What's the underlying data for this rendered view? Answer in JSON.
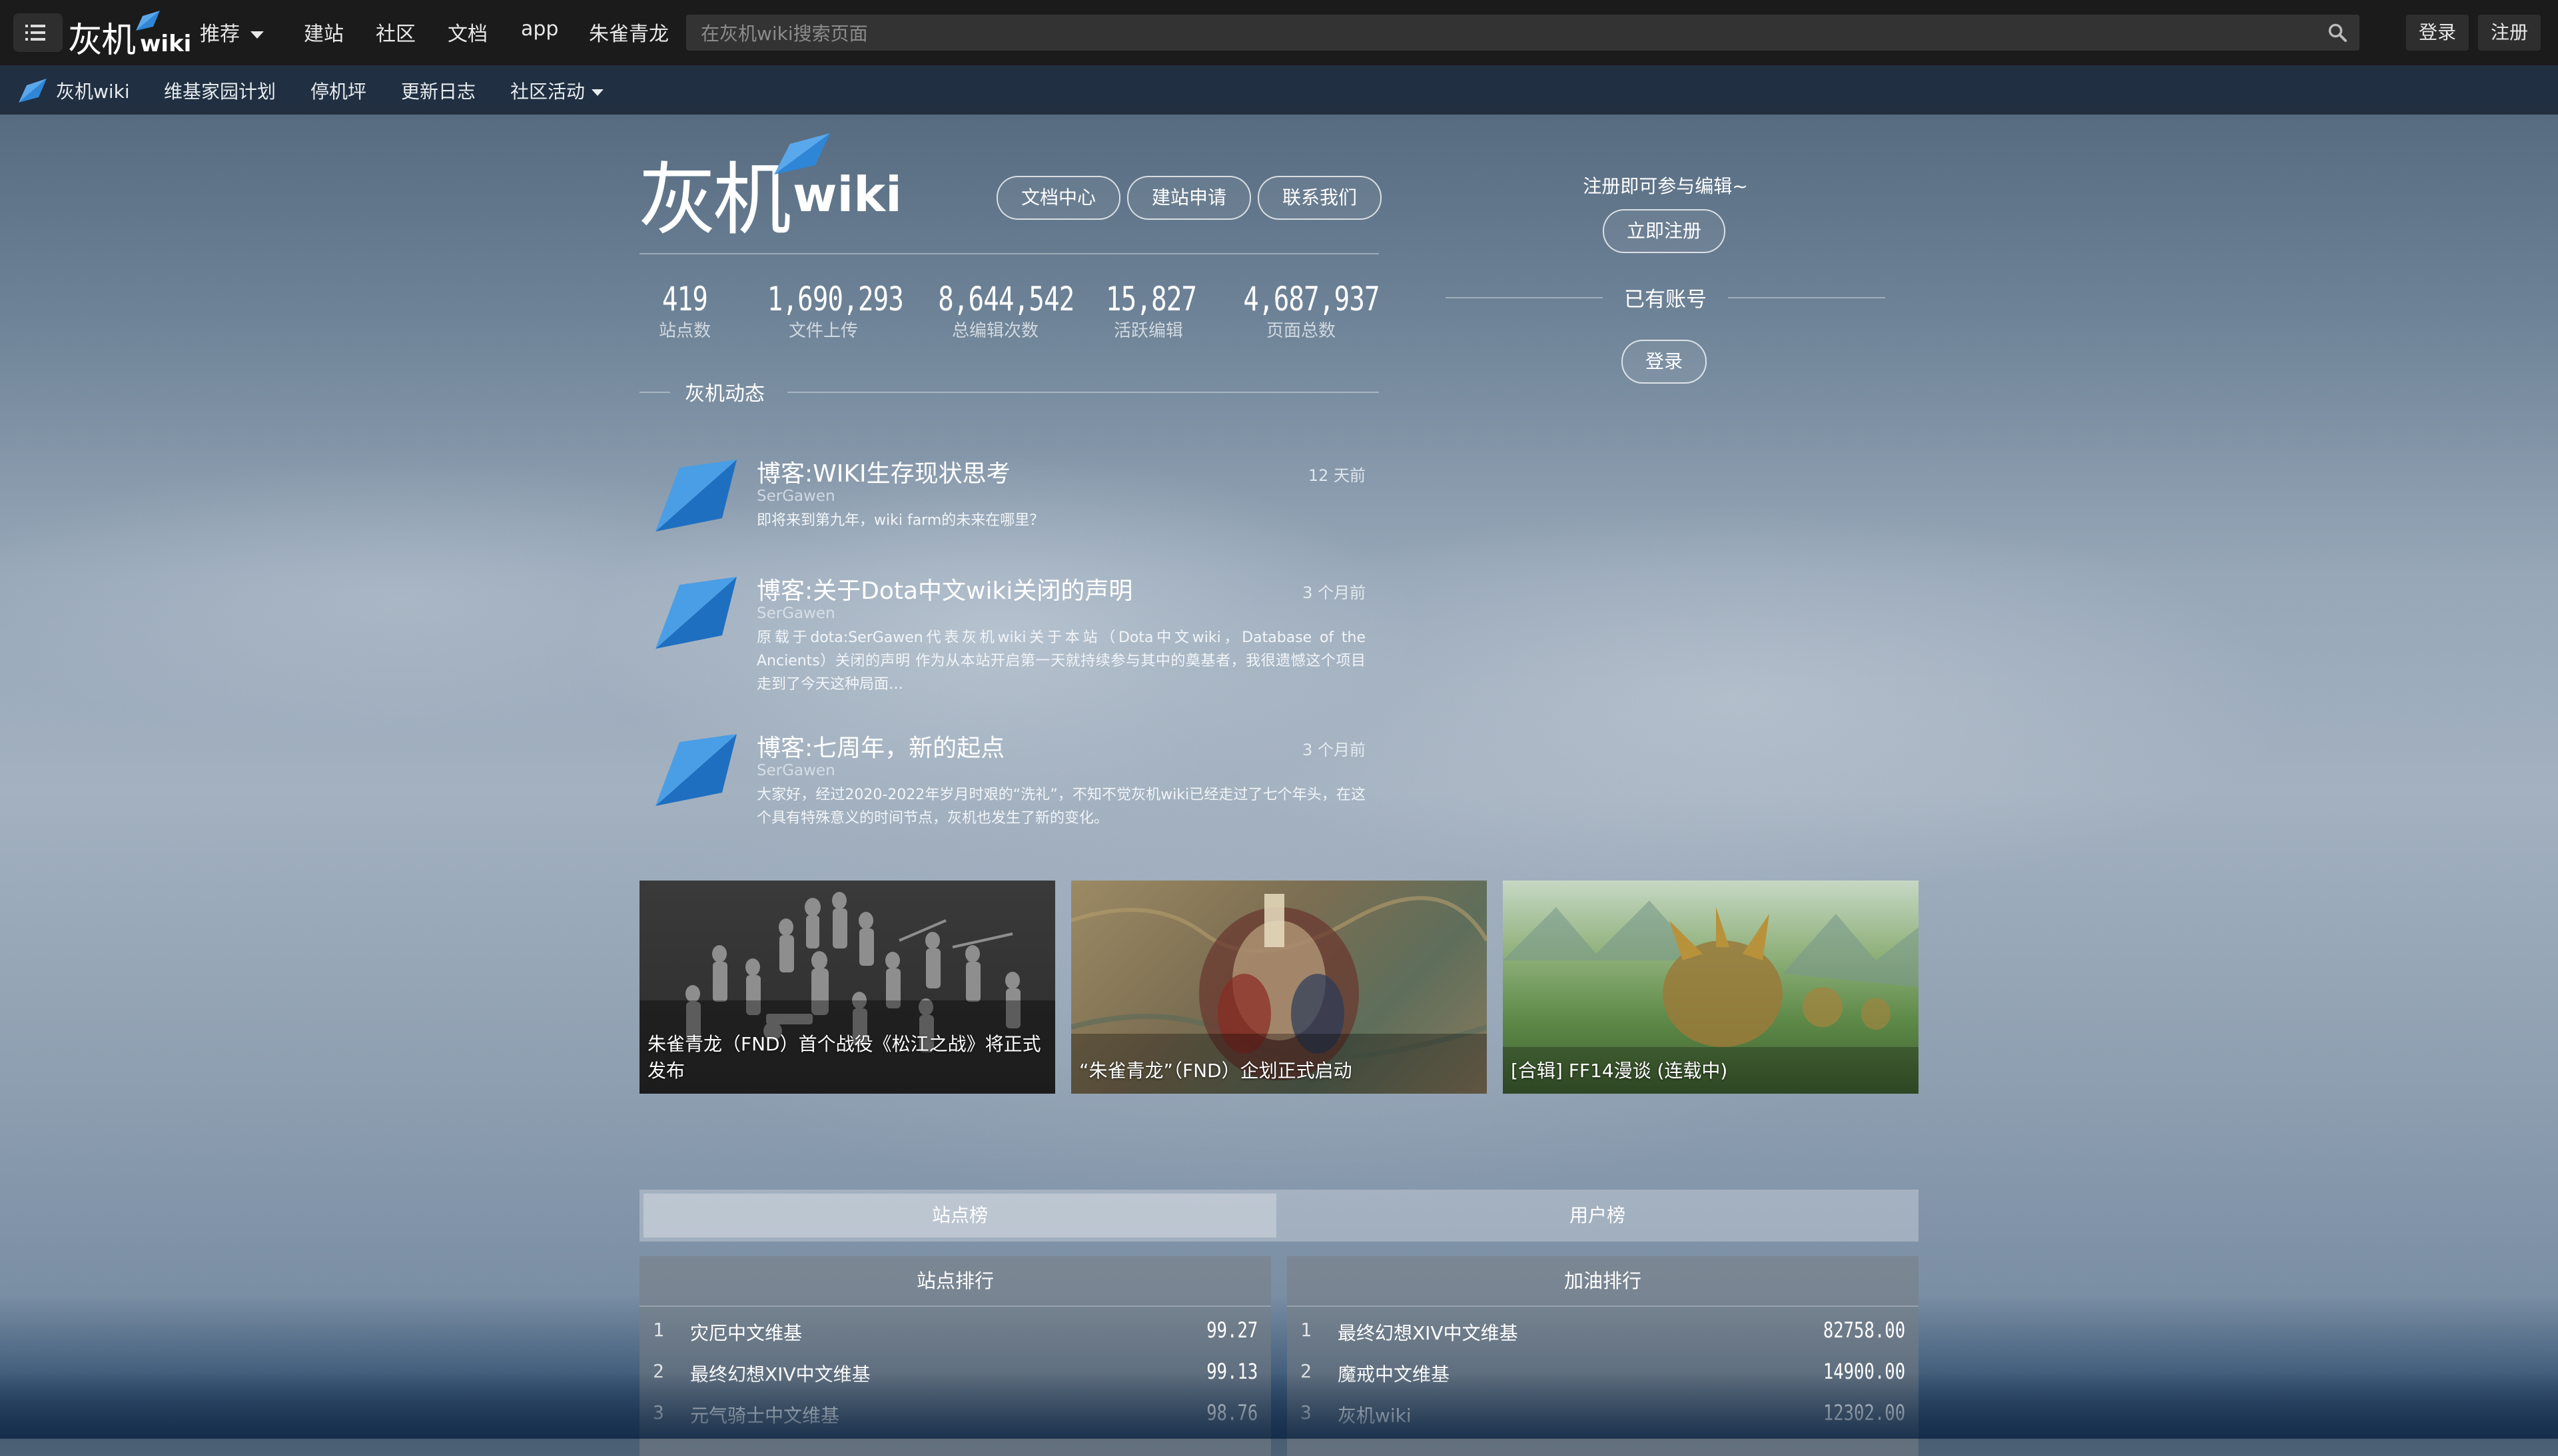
{
  "topbar": {
    "logo_cn": "灰机",
    "logo_en": "wiki",
    "nav": [
      "推荐",
      "建站",
      "社区",
      "文档",
      "app",
      "朱雀青龙"
    ],
    "search_placeholder": "在灰机wiki搜索页面",
    "login": "登录",
    "register": "注册"
  },
  "subbar": {
    "site_name": "灰机wiki",
    "items": [
      "维基家园计划",
      "停机坪",
      "更新日志",
      "社区活动"
    ]
  },
  "hero": {
    "logo_cn": "灰机",
    "logo_en": "wiki",
    "buttons": [
      "文档中心",
      "建站申请",
      "联系我们"
    ]
  },
  "stats": [
    {
      "value": "419",
      "label": "站点数"
    },
    {
      "value": "1,690,293",
      "label": "文件上传"
    },
    {
      "value": "8,644,542",
      "label": "总编辑次数"
    },
    {
      "value": "15,827",
      "label": "活跃编辑"
    },
    {
      "value": "4,687,937",
      "label": "页面总数"
    }
  ],
  "news": {
    "title": "灰机动态",
    "posts": [
      {
        "title": "博客:WIKI生存现状思考",
        "author": "SerGawen",
        "time": "12 天前",
        "excerpt": "即将来到第九年，wiki farm的未来在哪里？"
      },
      {
        "title": "博客:关于Dota中文wiki关闭的声明",
        "author": "SerGawen",
        "time": "3 个月前",
        "excerpt": "原载于dota:SerGawen代表灰机wiki关于本站（Dota中文wiki，Database of the Ancients）关闭的声明 作为从本站开启第一天就持续参与其中的奠基者，我很遗憾这个项目走到了今天这种局面…"
      },
      {
        "title": "博客:七周年，新的起点",
        "author": "SerGawen",
        "time": "3 个月前",
        "excerpt": "大家好，经过2020-2022年岁月时艰的“洗礼”，不知不觉灰机wiki已经走过了七个年头，在这个具有特殊意义的时间节点，灰机也发生了新的变化。"
      }
    ]
  },
  "cards": [
    {
      "caption": "朱雀青龙（FND）首个战役《松江之战》将正式发布"
    },
    {
      "caption": "“朱雀青龙”（FND）企划正式启动"
    },
    {
      "caption": "[合辑] FF14漫谈 (连载中)"
    }
  ],
  "account": {
    "prompt": "注册即可参与编辑~",
    "register_btn": "立即注册",
    "have_account": "已有账号",
    "login_btn": "登录"
  },
  "ranking": {
    "tabs": [
      "站点榜",
      "用户榜"
    ],
    "sites": {
      "title": "站点排行",
      "rows": [
        {
          "rank": "1",
          "name": "灾厄中文维基",
          "score": "99.27"
        },
        {
          "rank": "2",
          "name": "最终幻想XIV中文维基",
          "score": "99.13"
        },
        {
          "rank": "3",
          "name": "元气骑士中文维基",
          "score": "98.76"
        }
      ]
    },
    "fuel": {
      "title": "加油排行",
      "rows": [
        {
          "rank": "1",
          "name": "最终幻想XIV中文维基",
          "score": "82758.00"
        },
        {
          "rank": "2",
          "name": "魔戒中文维基",
          "score": "14900.00"
        },
        {
          "rank": "3",
          "name": "灰机wiki",
          "score": "12302.00"
        }
      ]
    }
  },
  "colors": {
    "brand_blue": "#2f86d6",
    "topbar_bg": "#1b1b1b",
    "subbar_bg": "#1c2a3c"
  }
}
